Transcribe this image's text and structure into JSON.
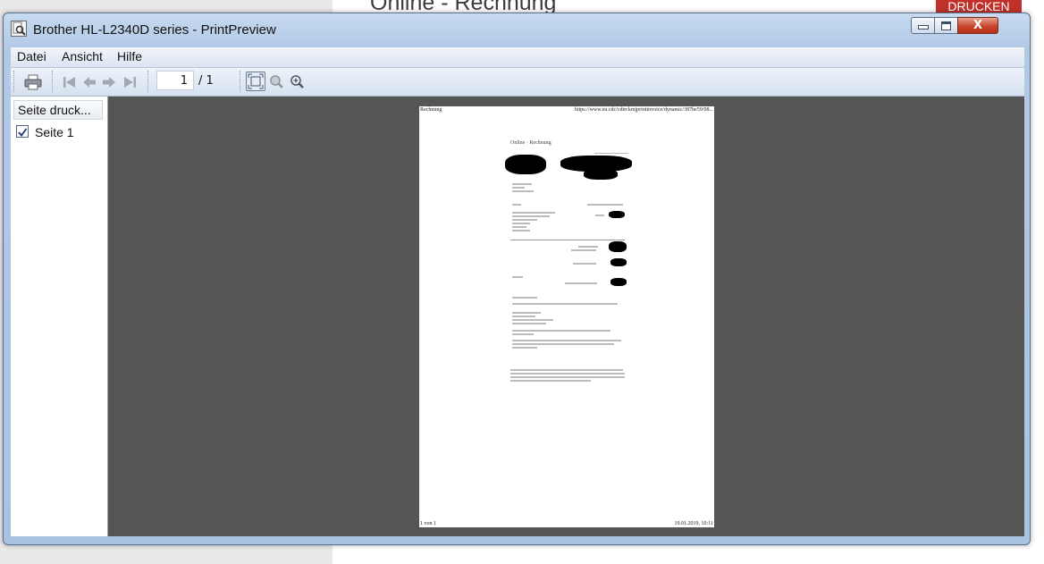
{
  "background_page": {
    "title": "Online - Rechnung",
    "print_button": "DRUCKEN"
  },
  "window": {
    "title": "Brother HL-L2340D series - PrintPreview",
    "controls": {
      "close": "X"
    }
  },
  "menu": {
    "items": [
      "Datei",
      "Ansicht",
      "Hilfe"
    ]
  },
  "toolbar": {
    "current_page": "1",
    "total_pages": "/ 1",
    "icons": [
      "printer-icon",
      "first-page-icon",
      "previous-page-icon",
      "next-page-icon",
      "last-page-icon",
      "zoom-fit-icon",
      "zoom-out-icon",
      "zoom-in-icon"
    ]
  },
  "pages_panel": {
    "header": "Seite druck...",
    "pages": [
      {
        "label": "Seite 1",
        "checked": true
      }
    ]
  },
  "preview": {
    "header_left": "Rechnung",
    "header_right": "https://www.eu.cdc/cdtrckmjprintinvoice/dynamic/387he59/08...",
    "title": "Online · Rechnung",
    "footer_left": "1 von 1",
    "footer_right": "19.01.2019, 10:11"
  },
  "colors": {
    "window_frame": "#b2c9e6",
    "preview_background": "#555555",
    "close_button": "#c8452c",
    "print_button": "#c0312a"
  }
}
